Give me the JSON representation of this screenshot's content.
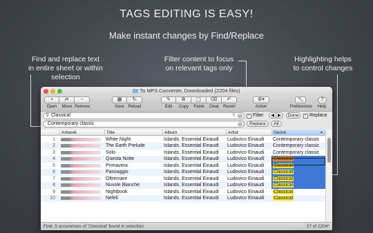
{
  "headline": "TAGS EDITING IS EASY!",
  "subheadline": "Make instant changes by Find/Replace",
  "callouts": {
    "find_replace_line1": "Find and replace text",
    "find_replace_line2": "in entire sheet or within selection",
    "filter_line1": "Filter content to focus",
    "filter_line2": "on relevant tags only",
    "highlight_line1": "Highlighting helps",
    "highlight_line2": "to control changes"
  },
  "window": {
    "title": "To MP3 Converter, Downloaded (2204 files)"
  },
  "toolbar": {
    "open": "Open",
    "move": "Move",
    "remove": "Remove",
    "save": "Save",
    "reload": "Reload",
    "edit": "Edit",
    "copy": "Copy",
    "paste": "Paste",
    "clear": "Clear",
    "revert": "Revert",
    "action": "Action",
    "preferences": "Preferences",
    "help": "Help",
    "glyphs": {
      "open": "+",
      "move": "⇄",
      "remove": "−",
      "save": "▦",
      "reload": "↻",
      "edit": "✎",
      "copy": "⧉",
      "paste": "📋",
      "clear": "⌫",
      "revert": "↶",
      "action": "⚙▾",
      "preferences": "🔧",
      "help": "?"
    }
  },
  "search": {
    "find_value": "Classical",
    "match_count": "5",
    "replace_value": "Contemporary classic",
    "filter_label": "Filter",
    "filter_checked": "✓",
    "replace_checkbox_label": "Replace",
    "replace_checked": "✓",
    "prev": "◀",
    "next": "▶",
    "done_label": "Done",
    "replace_button": "Replace",
    "all_button": "All"
  },
  "table": {
    "columns": [
      "",
      "Artwork",
      "Title",
      "Album",
      "Artist",
      "Genre"
    ],
    "sort_indicator": "▲",
    "rows": [
      {
        "n": "1",
        "title": "White Night",
        "album": "Islands. Essential Einaudi",
        "artist": "Ludovico Einaudi",
        "genre": "Contemporary classic"
      },
      {
        "n": "2",
        "title": "The Earth Prelude",
        "album": "Islands. Essential Einaudi",
        "artist": "Ludovico Einaudi",
        "genre": "Contemporary classic"
      },
      {
        "n": "3",
        "title": "Solo",
        "album": "Islands. Essential Einaudi",
        "artist": "Ludovico Einaudi",
        "genre": "Contemporary classic"
      },
      {
        "n": "4",
        "title": "Questa Notte",
        "album": "Islands. Essential Einaudi",
        "artist": "Ludovico Einaudi",
        "genre": "Classical"
      },
      {
        "n": "5",
        "title": "Primavera",
        "album": "Islands. Essential Einaudi",
        "artist": "Ludovico Einaudi",
        "genre": "Classical"
      },
      {
        "n": "6",
        "title": "Passaggio",
        "album": "Islands. Essential Einaudi",
        "artist": "Ludovico Einaudi",
        "genre": "Classical"
      },
      {
        "n": "7",
        "title": "Oltremare",
        "album": "Islands. Essential Einaudi",
        "artist": "Ludovico Einaudi",
        "genre": "Classical"
      },
      {
        "n": "8",
        "title": "Nuvole Bianche",
        "album": "Islands. Essential Einaudi",
        "artist": "Ludovico Einaudi",
        "genre": "Classical"
      },
      {
        "n": "9",
        "title": "Nightbook",
        "album": "Islands. Essential Einaudi",
        "artist": "Ludovico Einaudi",
        "genre": "Classical"
      },
      {
        "n": "10",
        "title": "Nefeli",
        "album": "Islands. Essential Einaudi",
        "artist": "Ludovico Einaudi",
        "genre": "Classical"
      }
    ]
  },
  "status": {
    "left": "Find: 5 occurences of 'Classical' found in selection.",
    "right": "27 of 2204*"
  },
  "colors": {
    "selection": "#3f78d6",
    "highlight": "#f2e33d",
    "current_match": "#f08a1e"
  }
}
